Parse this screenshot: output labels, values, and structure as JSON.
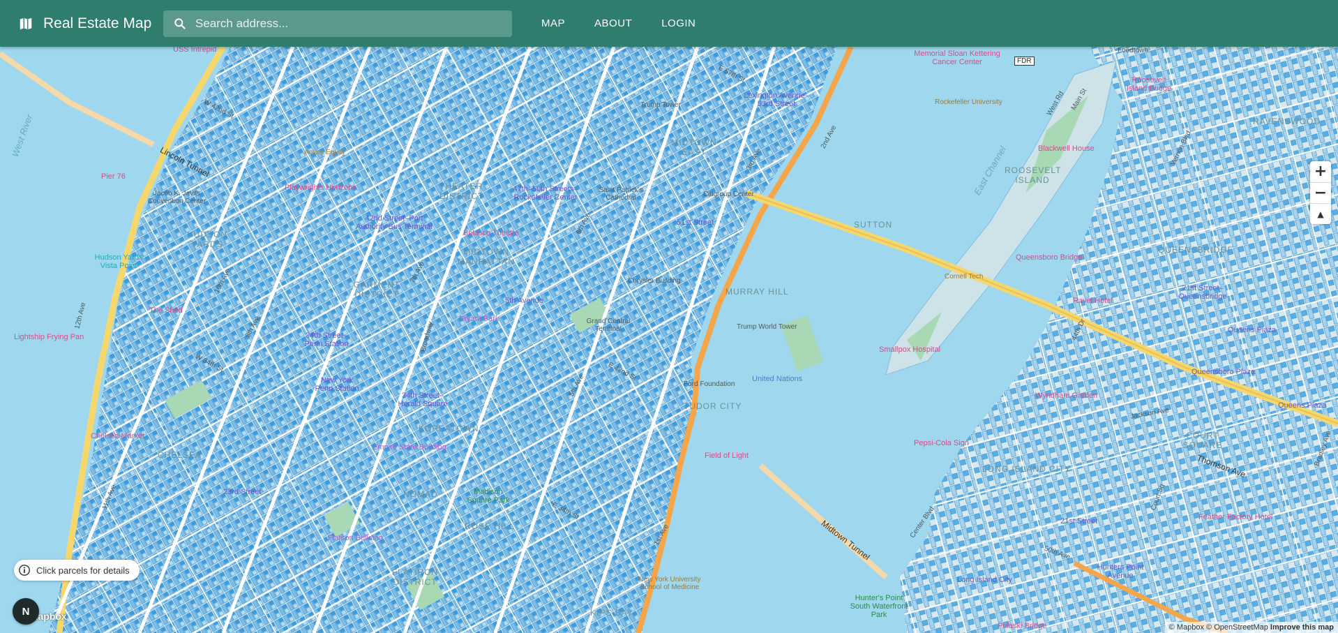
{
  "app": {
    "title": "Real Estate Map",
    "brand_icon": "map-icon"
  },
  "search": {
    "placeholder": "Search address...",
    "value": ""
  },
  "nav": {
    "items": [
      {
        "label": "MAP"
      },
      {
        "label": "ABOUT"
      },
      {
        "label": "LOGIN"
      }
    ]
  },
  "map": {
    "hint": "Click parcels for details",
    "compass": "N",
    "logo": "mapbox",
    "attribution": "© Mapbox © OpenStreetMap",
    "attribution_link": "Improve this map",
    "zoom_in": "+",
    "zoom_out": "−",
    "reset_north": "▲",
    "labels": {
      "l0": "USS Intrepid",
      "l1": "Pier 76",
      "l2": "Jacob K. Javits Convention Center",
      "l3": "HUDSON YARDS",
      "l4": "Hudson Yards Vista Point",
      "l5": "Lightship Frying Pan",
      "l6": "Lincoln Tunnel",
      "l7": "Actors Equity",
      "l8": "42nd Street–Port Authority Bus Terminal",
      "l9": "Playwrights Horizons",
      "l10": "THEATER DISTRICT",
      "l11": "MIDTOWN MANHATTAN",
      "l12": "Belasco Theatre",
      "l13": "47th–50th Streets–Rockefeller Center",
      "l14": "Saint Patrick's Cathedral",
      "l15": "Trump Tower",
      "l16": "MIDTOWN EAST",
      "l17": "Citigroup Center",
      "l18": "51st Street",
      "l19": "Lexington Avenue–53rd Street",
      "l20": "Memorial Sloan Kettering Cancer Center",
      "l21": "Rockefeller University",
      "l22": "ROOSEVELT ISLAND",
      "l23": "Blackwell House",
      "l24": "Roosevelt Island Bridge",
      "l25": "Foodtown",
      "l26": "RAVENSWOOD",
      "l27": "QUEENSBRIDGE",
      "l28": "Queensboro Bridge",
      "l29": "Cornell Tech",
      "l30": "Smallpox Hospital",
      "l31": "SUTTON",
      "l32": "United Nations",
      "l33": "Ford Foundation",
      "l34": "TUDOR CITY",
      "l35": "Trump World Tower",
      "l36": "Grand Central Terminal",
      "l37": "5th Avenue",
      "l38": "Bryant Park",
      "l39": "34th Street–Penn Station",
      "l40": "New York Penn Station",
      "l41": "The Shed",
      "l42": "34th Street–Herald Square",
      "l43": "KOREATOWN",
      "l44": "GARMENT DISTRICT",
      "l45": "Chrysler Building",
      "l46": "MURRAY HILL",
      "l47": "Midtown Tunnel",
      "l48": "Field of Light",
      "l49": "New York University School of Medicine",
      "l50": "KIPS BAY",
      "l51": "Hunter's Point South Waterfront Park",
      "l52": "Pulaski Bridge",
      "l53": "Long Island City",
      "l54": "LONG ISLAND CITY",
      "l55": "Pepsi-Cola Sign",
      "l56": "Wyndham Garden",
      "l57": "Queens Plaza",
      "l58": "Queensboro Plaza",
      "l59": "COURT SQUARE",
      "l60": "Thomson Ave",
      "l61": "Feather Factory Hotel",
      "l62": "Hunters Point Avenue",
      "l63": "21st Street",
      "l64": "21st Street–Queensbridge",
      "l65": "Ravel Hotel",
      "l66": "Chelsea Market",
      "l67": "CHELSEA",
      "l68": "23rd Street",
      "l69": "Empire State Building",
      "l70": "NOMAD",
      "l71": "FLATIRON DISTRICT",
      "l72": "ROSE HILL",
      "l73": "Madison Square Park",
      "l74": "West River",
      "l75": "East Channel",
      "l76": "Broadway",
      "l77": "12th Ave",
      "l78": "11th Ave",
      "l79": "10th Ave",
      "l80": "9th Ave",
      "l81": "7th Ave",
      "l82": "6th Ave",
      "l83": "5th Ave",
      "l84": "3rd Ave",
      "l85": "2nd Ave",
      "l86": "1st Ave",
      "l87": "W 42nd St",
      "l88": "W 34th St",
      "l89": "E 42nd St",
      "l90": "E 34th St",
      "l91": "E 57th St",
      "l92": "FDR",
      "l93": "Vernon Blvd",
      "l94": "Jackson Ave",
      "l95": "Bradley Ave",
      "l96": "Main St",
      "l97": "West Rd",
      "l98": "44th Dr",
      "l99": "Center Blvd",
      "l100": "50th Ave",
      "l101": "Court Sq",
      "l102": "Queens Plaza",
      "l103": "Flatiron Building"
    }
  },
  "colors": {
    "header": "#2e7d6e",
    "water": "#9fd8ee",
    "land": "#cfe4ec",
    "parcel": "#2a8fd6",
    "highway": "#f5a54a",
    "park": "#a9d8b4"
  }
}
